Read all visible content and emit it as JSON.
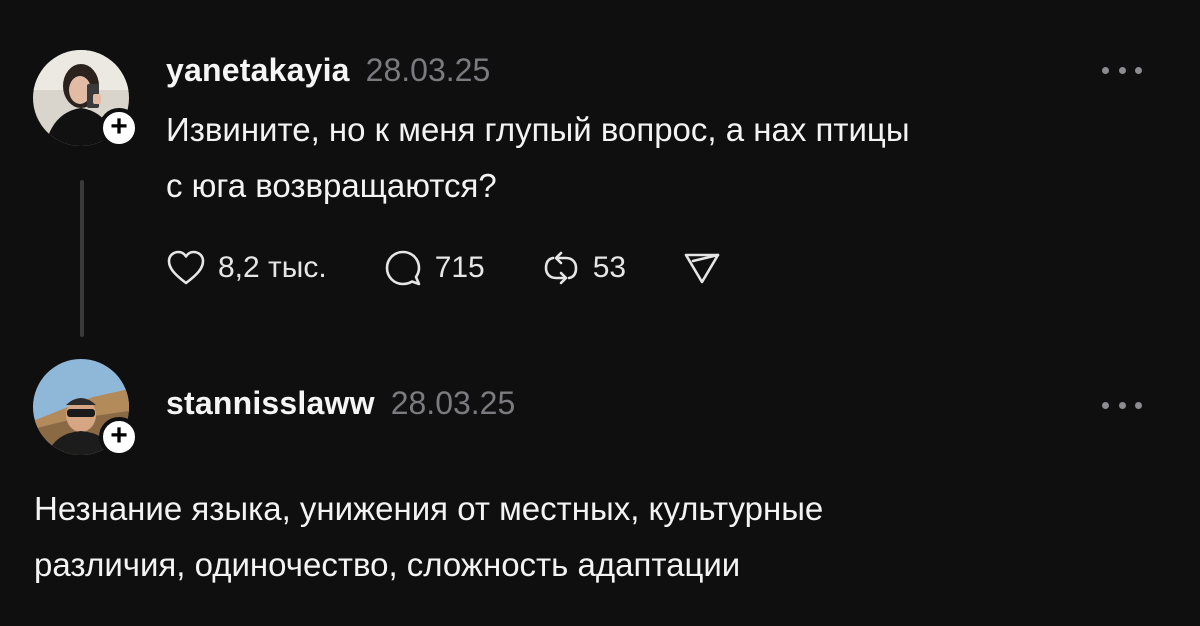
{
  "posts": [
    {
      "username": "yanetakayia",
      "date": "28.03.25",
      "text_line1": "Извините, но к меня глупый вопрос, а нах   птицы",
      "text_line2": "с юга возвращаются?",
      "likes": "8,2 тыс.",
      "replies": "715",
      "reposts": "53"
    },
    {
      "username": "stannisslaww",
      "date": "28.03.25",
      "text_line1": "Незнание языка, унижения от местных, культурные",
      "text_line2": "различия, одиночество, сложность адаптации"
    }
  ],
  "follow_symbol": "+",
  "icons": {
    "like": "heart-icon",
    "reply": "comment-bubble-icon",
    "repost": "repost-arrows-icon",
    "share": "send-icon",
    "more": "more-dots-icon"
  }
}
